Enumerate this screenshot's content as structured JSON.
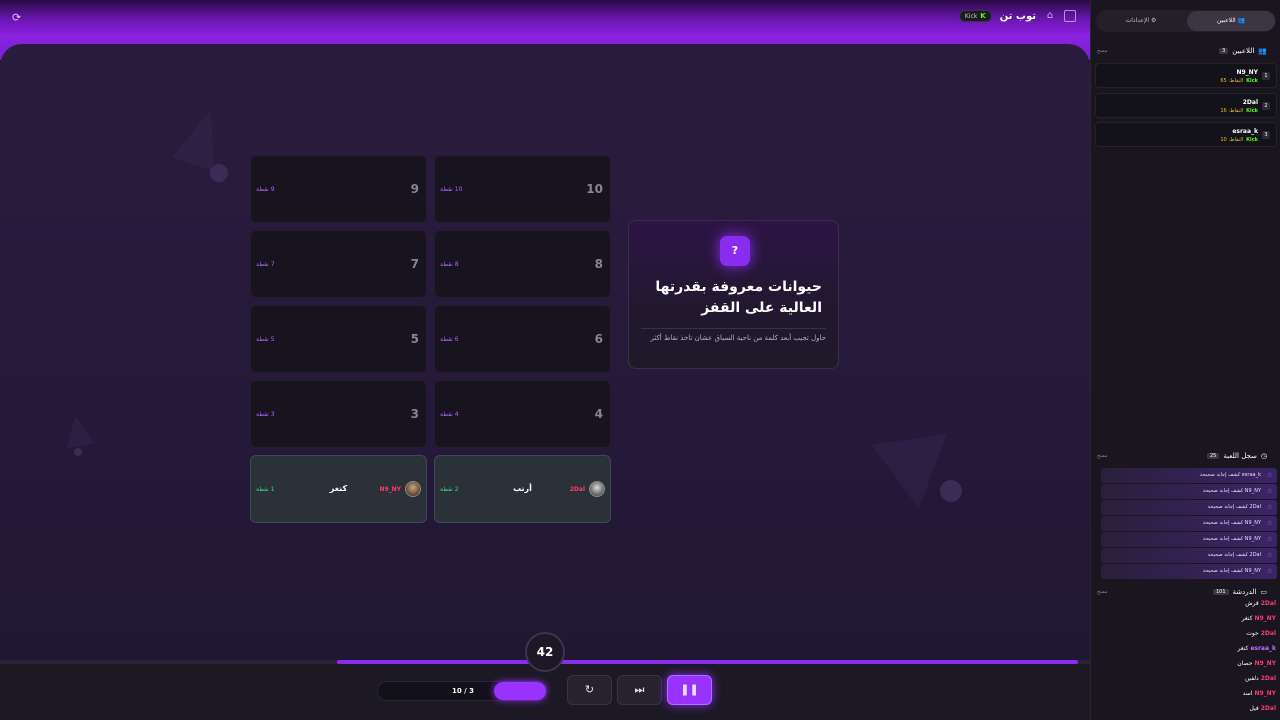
{
  "app": {
    "title": "توب تن",
    "kick_badge": "Kick"
  },
  "question": {
    "title": "حيوانات معروفة بقدرتها العالية على القفز",
    "hint": "حاول تجيب أبعد كلمة من ناحية السباق عشان تاخذ نقاط أكثر",
    "mark": "?"
  },
  "grid": {
    "cells": [
      {
        "num": "10",
        "pts": "10 نقطة"
      },
      {
        "num": "9",
        "pts": "9 نقطة"
      },
      {
        "num": "8",
        "pts": "8 نقطة"
      },
      {
        "num": "7",
        "pts": "7 نقطة"
      },
      {
        "num": "6",
        "pts": "6 نقطة"
      },
      {
        "num": "5",
        "pts": "5 نقطة"
      },
      {
        "num": "4",
        "pts": "4 نقطة"
      },
      {
        "num": "3",
        "pts": "3 نقطة"
      }
    ],
    "answered": [
      {
        "word": "أرنب",
        "pts": "2 نقطة",
        "who": "2Dal"
      },
      {
        "word": "كنغر",
        "pts": "1 نقطة",
        "who": "N9_NY"
      }
    ]
  },
  "timer": "42",
  "round": "10 / 3",
  "progress": 0.68,
  "sidebar": {
    "tab_players": "اللاعبين",
    "tab_settings": "الإعدادات",
    "players_title": "اللاعبين",
    "players_count": "3",
    "clear": "مسح",
    "players": [
      {
        "rank": "1",
        "name": "N9_NY",
        "kick": "Kick",
        "score": "النقاط: 65"
      },
      {
        "rank": "2",
        "name": "2Dal",
        "kick": "Kick",
        "score": "النقاط: 16"
      },
      {
        "rank": "3",
        "name": "esraa_k",
        "kick": "Kick",
        "score": "النقاط: 10"
      }
    ],
    "log_title": "سجل اللعبة",
    "log_count": "25",
    "log": [
      "esraa_k كشف إجابة صحيحة",
      "N9_NY كشف إجابة صحيحة",
      "2Dal كشف إجابة صحيحة",
      "N9_NY كشف إجابة صحيحة",
      "N9_NY كشف إجابة صحيحة",
      "2Dal كشف إجابة صحيحة",
      "N9_NY كشف إجابة صحيحة"
    ],
    "chat_title": "الدردشة",
    "chat_count": "101",
    "chat": [
      {
        "user": "2Dal",
        "msg": "قرش"
      },
      {
        "user": "N9_NY",
        "msg": "كنغر"
      },
      {
        "user": "2Dal",
        "msg": "حوت"
      },
      {
        "user": "esraa_k",
        "msg": "كنغر"
      },
      {
        "user": "N9_NY",
        "msg": "حصان"
      },
      {
        "user": "2Dal",
        "msg": "دلفين"
      },
      {
        "user": "N9_NY",
        "msg": "اسد"
      },
      {
        "user": "2Dal",
        "msg": "فيل"
      }
    ]
  }
}
